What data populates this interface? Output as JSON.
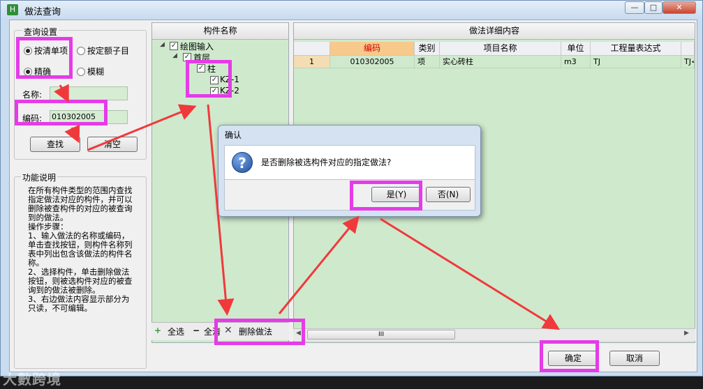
{
  "window": {
    "title": "做法查询",
    "app_icon_glyph": "H",
    "minimize_glyph": "—",
    "restore_glyph": "□",
    "close_glyph": "✕"
  },
  "query_settings": {
    "group_label": "查询设置",
    "radio_by_item": "按清单项",
    "radio_by_quota": "按定额子目",
    "radio_exact": "精确",
    "radio_fuzzy": "模糊",
    "name_label": "名称:",
    "name_value": "",
    "code_label": "编码:",
    "code_value": "010302005",
    "search_button": "查找",
    "clear_button": "清空"
  },
  "help": {
    "group_label": "功能说明",
    "text": "在所有构件类型的范围内查找指定做法对应的构件，并可以删除被查构件的对应的被查询到的做法。\n操作步骤：\n1、输入做法的名称或编码，单击查找按钮，则构件名称列表中列出包含该做法的构件名称。\n2、选择构件，单击删除做法按钮，则被选构件对应的被查询到的做法被删除。\n3、右边做法内容显示部分为只读，不可编辑。"
  },
  "component_tree": {
    "header": "构件名称",
    "items": [
      {
        "label": "绘图输入",
        "checked": true
      },
      {
        "label": "首层",
        "checked": true
      },
      {
        "label": "柱",
        "checked": true
      },
      {
        "label": "KZ-1",
        "checked": true
      },
      {
        "label": "KZ-2",
        "checked": true
      }
    ],
    "select_all": "全选",
    "clear_all": "全清",
    "delete_method": "删除做法"
  },
  "detail": {
    "header": "做法详细内容",
    "columns": [
      "编码",
      "类别",
      "项目名称",
      "单位",
      "工程量表达式"
    ],
    "rows": [
      {
        "index": "1",
        "code": "010302005",
        "type": "项",
        "name": "实心砖柱",
        "unit": "m3",
        "expr": "TJ",
        "extra": "TJ<"
      }
    ],
    "scroll_label": "III"
  },
  "dialog": {
    "title": "确认",
    "message": "是否删除被选构件对应的指定做法?",
    "yes": "是(Y)",
    "no": "否(N)"
  },
  "footer": {
    "ok": "确定",
    "cancel": "取消"
  },
  "watermark": "大數跨境",
  "colors": {
    "highlight": "#e53be8",
    "arrow": "#f0393b",
    "pane_green": "#cfe9cd",
    "header_orange": "#f7c98a"
  }
}
